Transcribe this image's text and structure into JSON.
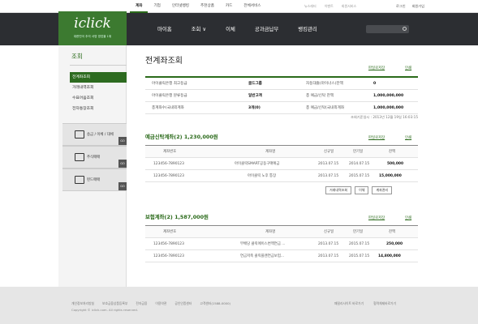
{
  "topnav": [
    "계좌",
    "기업",
    "인터넷뱅킹",
    "추천상품",
    "카드",
    "전체서비스"
  ],
  "toplinks": [
    "뉴스레터",
    "이벤트",
    "회원서비스"
  ],
  "userlinks": [
    "로그인",
    "회원가입"
  ],
  "logo": {
    "name": "iclick",
    "tagline": "대한민국 추석 서영 영업을 1위"
  },
  "mainnav": [
    "마이홈",
    "조회 ∨",
    "이체",
    "공과금납부",
    "뱅킹관리"
  ],
  "search": {
    "placeholder": ""
  },
  "sidebar": {
    "title": "조회",
    "items": [
      "전계좌조회",
      "거래내역조회",
      "수표어음조회",
      "전자통장조회"
    ],
    "quick": [
      "송금 / 이체 / 대체",
      "주식매매",
      "펀드매매"
    ],
    "go": "GO"
  },
  "page": {
    "title": "전계좌조회",
    "print_links": [
      "파일로저장",
      "인쇄"
    ],
    "info": [
      {
        "label": "아이클릭은행 최고등급",
        "value": "골드그룹",
        "label2": "자동대출(마이너스)잔액",
        "value2": "0"
      },
      {
        "label": "아이클릭은행 분류등급",
        "value": "일반고객",
        "label2": "총 예금/신탁 잔액",
        "value2": "1,000,000,000"
      },
      {
        "label": "총계좌수(국내외계좌",
        "value": "3개(0)",
        "label2": "총 예금/신탁(국내외계좌",
        "value2": "1,000,000,000"
      }
    ],
    "as_of": "조회기준일시 : 2013년 12월 19일 16:03:15"
  },
  "deposit": {
    "title_prefix": "예금신탁계좌",
    "count": "(2)",
    "total": "1,230,000원",
    "links": [
      "파일로저장",
      "인쇄"
    ],
    "headers": [
      "계좌번호",
      "계좌명",
      "신규일",
      "만기일",
      "잔액"
    ],
    "rows": [
      [
        "123456-7890123",
        "아이클릭SMART공동구매예금",
        "2013.07.15",
        "2014.07.15",
        "500,000"
      ],
      [
        "123456-7890123",
        "아이클릭 노후 통장",
        "2013.07.15",
        "2015.07.15",
        "15,000,000"
      ]
    ],
    "buttons": [
      "거래내역조회",
      "이체",
      "계좌관리"
    ]
  },
  "insurance": {
    "title_prefix": "보험계좌",
    "count": "(2)",
    "total": "1,587,000원",
    "links": [
      "파일로저장",
      "인쇄"
    ],
    "headers": [
      "계좌번호",
      "계좌명",
      "신규일",
      "만기일",
      "잔액"
    ],
    "rows": [
      [
        "123456-7890123",
        "무배당 클릭에이스변액연금 ...",
        "2013.07.15",
        "2015.07.15",
        "250,000"
      ],
      [
        "123456-7890123",
        "연금저축 클릭플랜연금보험...",
        "2013.07.15",
        "2015.07.15",
        "14,800,000"
      ]
    ]
  },
  "footer": {
    "links": [
      "개인정보처리방침",
      "보호금융상품등록부",
      "전자금융",
      "이용약관",
      "공인인증센터",
      "고객센터(1588-0000)"
    ],
    "right": [
      "패밀리사이트 바로가기",
      "협력체제바로가기"
    ],
    "copyright": "Copyright © iclick.com. All rights reserved."
  }
}
